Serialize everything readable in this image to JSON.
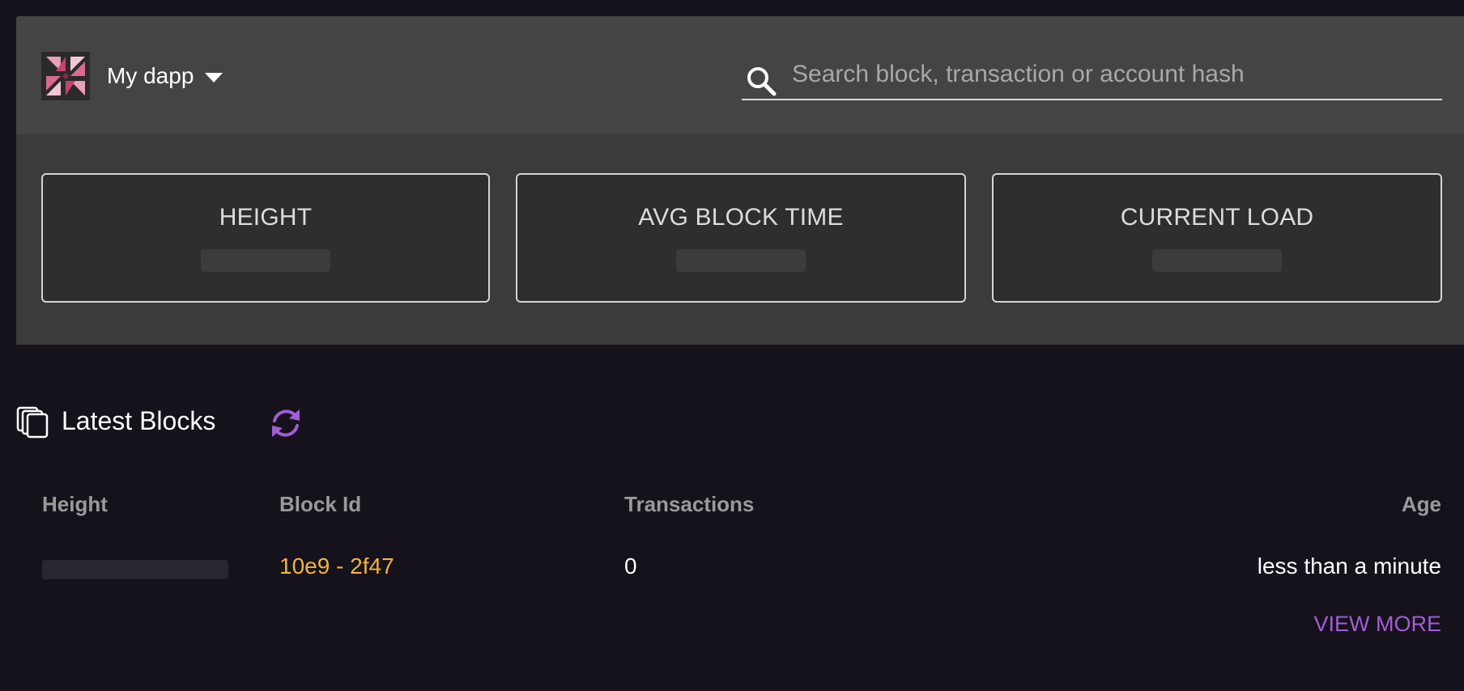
{
  "header": {
    "logo": "pinwheel-logo",
    "dapp_selector": {
      "label": "My dapp",
      "icon": "caret-down-icon"
    },
    "search": {
      "placeholder": "Search block, transaction or account hash",
      "value": "",
      "icon": "search-icon"
    }
  },
  "stats": [
    {
      "title": "HEIGHT",
      "value": ""
    },
    {
      "title": "AVG BLOCK TIME",
      "value": ""
    },
    {
      "title": "CURRENT LOAD",
      "value": ""
    }
  ],
  "latest_blocks": {
    "icon": "blocks-stack-icon",
    "title": "Latest Blocks",
    "refresh_icon": "refresh-icon",
    "columns": [
      "Height",
      "Block Id",
      "Transactions",
      "Age"
    ],
    "rows": [
      {
        "height": "",
        "block_id": "10e9 - 2f47",
        "transactions": "0",
        "age": "less than a minute"
      }
    ],
    "view_more_label": "VIEW MORE"
  },
  "colors": {
    "background": "#16121c",
    "panel": "#3b3b3b",
    "header": "#444444",
    "link": "#f0b43c",
    "accent": "#a05ed4"
  }
}
